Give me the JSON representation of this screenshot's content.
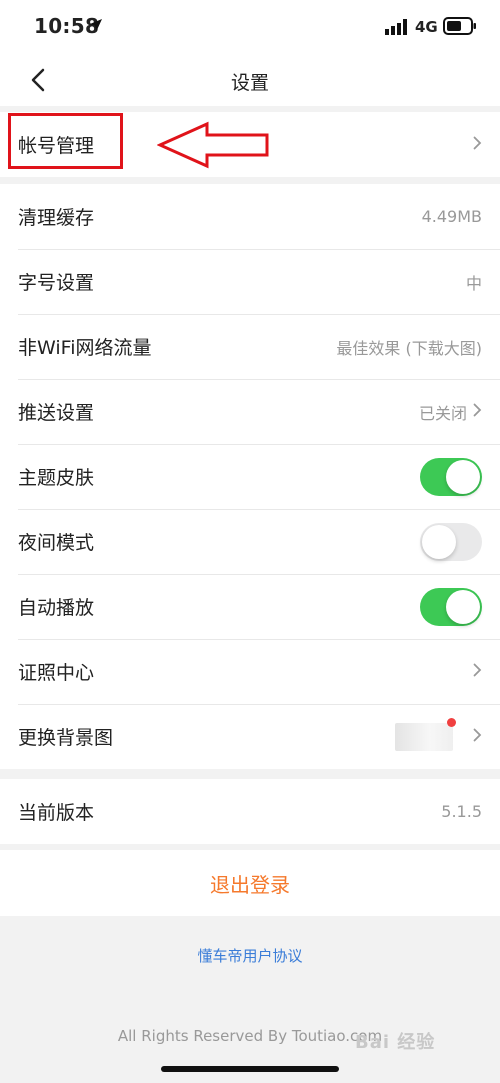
{
  "status_bar": {
    "time": "10:58",
    "network": "4G"
  },
  "nav": {
    "title": "设置"
  },
  "account_group": {
    "account_management": "帐号管理"
  },
  "settings": {
    "clear_cache": {
      "label": "清理缓存",
      "value": "4.49MB"
    },
    "font_size": {
      "label": "字号设置",
      "value": "中"
    },
    "non_wifi": {
      "label": "非WiFi网络流量",
      "value": "最佳效果 (下载大图)"
    },
    "push": {
      "label": "推送设置",
      "value": "已关闭"
    },
    "theme": {
      "label": "主题皮肤",
      "enabled": true
    },
    "night_mode": {
      "label": "夜间模式",
      "enabled": false
    },
    "autoplay": {
      "label": "自动播放",
      "enabled": true
    },
    "certificate": {
      "label": "证照中心"
    },
    "background": {
      "label": "更换背景图"
    }
  },
  "version": {
    "label": "当前版本",
    "value": "5.1.5"
  },
  "logout_label": "退出登录",
  "agreement_link": "懂车帝用户协议",
  "copyright": "All Rights Reserved By Toutiao.com",
  "watermark": "Bai 经验",
  "colors": {
    "accent_orange": "#f5792c",
    "toggle_on": "#3dc955",
    "toggle_off": "#e9e9ea",
    "link_blue": "#3b7dd8",
    "annotation_red": "#e0131a"
  }
}
